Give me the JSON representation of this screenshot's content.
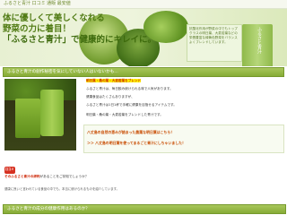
{
  "site": {
    "name": "ふるさと青汁 口コミ 通販 最安値"
  },
  "hero": {
    "headline": [
      "体に優しくて美しくなれる",
      "野菜の力に着目！",
      "「ふるさと青汁」で健康的にキレイに。"
    ],
    "note": "抗酸化作用が野菜の中でもトップクラスの明日葉、大麦若葉などの栄養豊富な緑黄色野菜をバランスよくブレンドしています。",
    "package_label": "ふるさと青汁"
  },
  "section1": {
    "heading": "ふるさと青汁の創作秘密を気にしていない人はいないかも…",
    "lines": [
      "明日葉・桑の葉・大麦若葉をブレンドした青汁です。",
      "ふるさと青汁は、毎日飲み続けられる味で人気があります。",
      "健康食品はたくさんありますが、",
      "ふるさと青汁は1日1杯で手軽に健康を目指せるアイテムです。"
    ],
    "highlight": "明日葉・桑の葉・大麦若葉をブレンド",
    "links": [
      "八丈島の自然の恵みが詰まった農薬な明日葉はこちら！",
      "＞＞ 八丈島の明日葉を使ってまるごと青汁にしちゃいました！"
    ],
    "badge": "口コミ",
    "caption_prefix": "そのふるさと青汁の評判",
    "caption_rest": "があることをご存知でしょうか？",
    "note": "健康に良いと言われている食品の中でも、本当に続けられるものを紹介しています。"
  },
  "section2": {
    "heading": "ふるさと青汁の成分の健康作用はあるのか？"
  },
  "colors": {
    "accent": "#86ab36",
    "highlight": "#fff200",
    "link": "#c84b00"
  }
}
